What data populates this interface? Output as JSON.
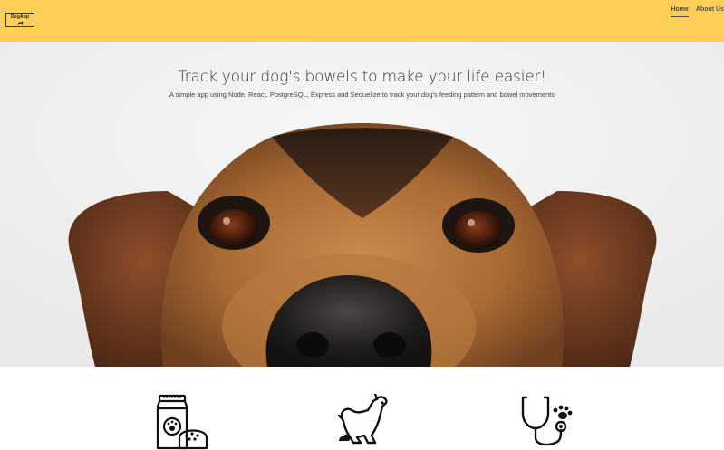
{
  "navbar": {
    "logo_text": "DogApp",
    "links": [
      {
        "label": "Home"
      },
      {
        "label": "About Us"
      }
    ],
    "background_color": "#fecf58"
  },
  "hero": {
    "title": "Track your dog's bowels to make your life easier!",
    "subtitle": "A simple app using Node, React, PostgreSQL, Express and Sequelize to track your dog's feeding pattern and bowel movements",
    "image": "dog-closeup-photo"
  },
  "features": {
    "icons": [
      "dog-food-icon",
      "dog-pooping-icon",
      "vet-stethoscope-icon"
    ]
  }
}
